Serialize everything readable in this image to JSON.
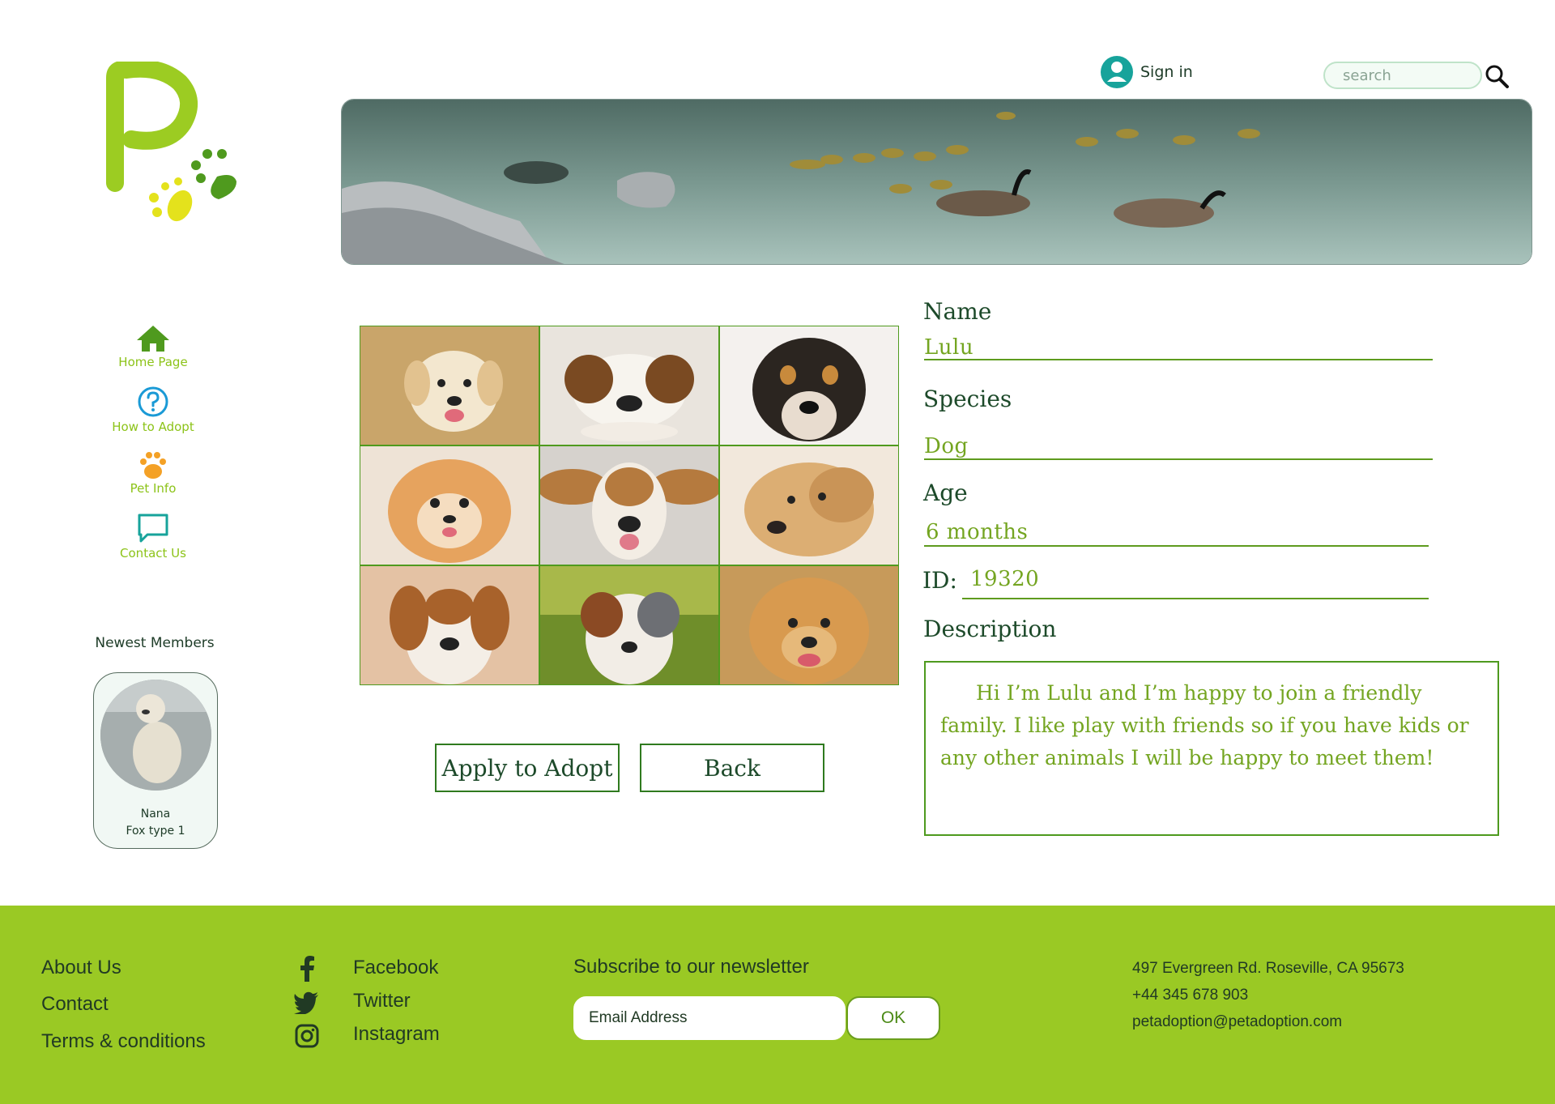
{
  "header": {
    "signin_label": "Sign in",
    "search_placeholder": "search"
  },
  "nav": {
    "items": [
      {
        "label": "Home Page",
        "icon": "home-icon",
        "color": "#4f9a1e"
      },
      {
        "label": "How to Adopt",
        "icon": "question-icon",
        "color": "#1a9ad6"
      },
      {
        "label": "Pet Info",
        "icon": "paw-icon",
        "color": "#f4a126"
      },
      {
        "label": "Contact Us",
        "icon": "chat-icon",
        "color": "#17a39b"
      }
    ]
  },
  "newest": {
    "title": "Newest Members",
    "member": {
      "name": "Nana",
      "type": "Fox type 1"
    }
  },
  "actions": {
    "apply_label": "Apply to Adopt",
    "back_label": "Back"
  },
  "pet": {
    "name_label": "Name",
    "name": "Lulu",
    "species_label": "Species",
    "species": "Dog",
    "age_label": "Age",
    "age": "6 months",
    "id_label": "ID:",
    "id": "19320",
    "description_label": "Description",
    "description": "Hi I’m Lulu and I’m happy to join a friendly family. I like play with friends so if you have kids or any other animals I will be happy to meet them!"
  },
  "footer": {
    "links": [
      "About Us",
      "Contact",
      "Terms & conditions"
    ],
    "social": [
      {
        "label": "Facebook",
        "icon": "facebook-icon"
      },
      {
        "label": "Twitter",
        "icon": "twitter-icon"
      },
      {
        "label": "Instagram",
        "icon": "instagram-icon"
      }
    ],
    "newsletter_title": "Subscribe to our newsletter",
    "email_placeholder": "Email Address",
    "ok_label": "OK",
    "address": "497 Evergreen Rd. Roseville, CA 95673",
    "phone": "+44 345 678 903",
    "email": "petadoption@petadoption.com"
  },
  "colors": {
    "brand_green": "#9ac924",
    "dark_green": "#1d4a2a",
    "accent_green": "#74a521"
  }
}
